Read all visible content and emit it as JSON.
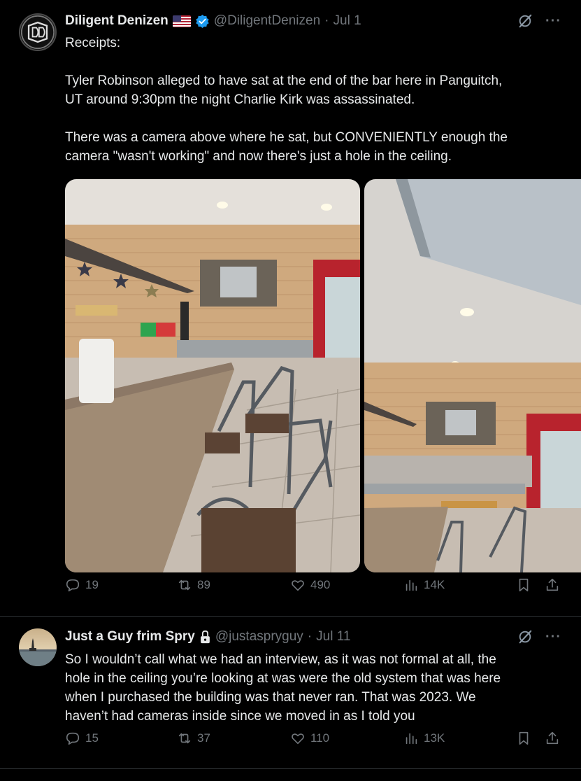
{
  "tweet1": {
    "display_name": "Diligent Denizen",
    "handle": "@DiligentDenizen",
    "separator": "·",
    "date": "Jul 1",
    "lines": [
      "Receipts:",
      "",
      "Tyler Robinson alleged to have sat at the end of the bar here in Panguitch,",
      "UT around 9:30pm the night Charlie Kirk was assassinated.",
      "",
      "There was a camera above where he sat, but CONVENIENTLY enough the",
      "camera \"wasn't working\" and now there's just a hole in the ceiling."
    ],
    "stats": {
      "replies": "19",
      "reposts": "89",
      "likes": "490",
      "views": "14K"
    }
  },
  "tweet2": {
    "display_name": "Just a Guy frim Spry",
    "handle": "@justaspryguy",
    "separator": "·",
    "date": "Jul 11",
    "lines": [
      "So I wouldn’t call what we had an interview, as it was not formal at all, the",
      "hole in the ceiling you’re looking at was were the old system that was here",
      "when I purchased the building was that never ran. That was 2023. We",
      "haven’t had cameras inside since we moved in as I told you"
    ],
    "stats": {
      "replies": "15",
      "reposts": "37",
      "likes": "110",
      "views": "13K"
    }
  },
  "icons": {
    "reply": "reply-icon",
    "repost": "repost-icon",
    "like": "heart-icon",
    "views": "views-icon",
    "bookmark": "bookmark-icon",
    "share": "share-icon",
    "grok": "grok-icon",
    "more": "more-icon",
    "verified": "verified-badge-icon",
    "flag": "us-flag-icon",
    "lock": "lock-icon"
  },
  "colors": {
    "background": "#000000",
    "text": "#e7e9ea",
    "muted": "#71767b",
    "verified": "#1d9bf0",
    "divider": "#2f3336"
  }
}
